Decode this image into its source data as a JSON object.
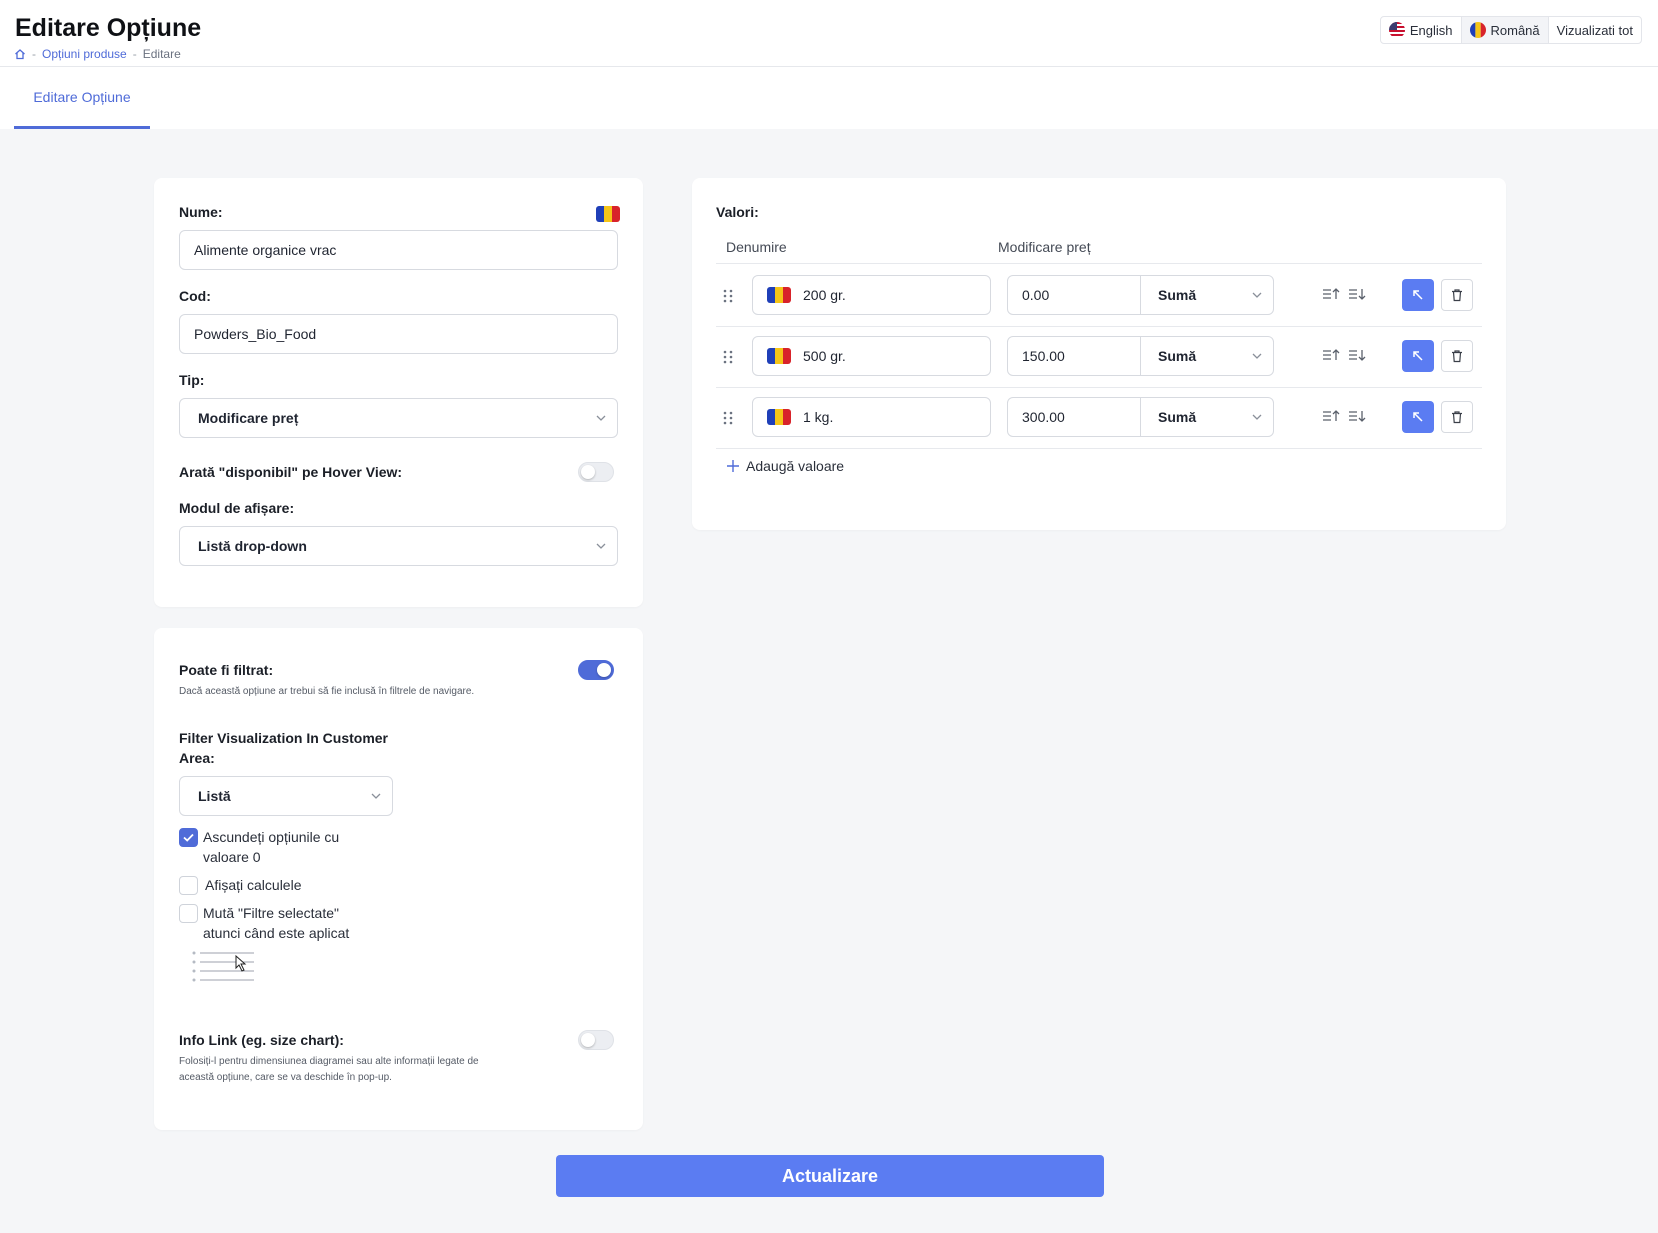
{
  "header": {
    "title": "Editare Opțiune",
    "breadcrumb": [
      "Opțiuni produse",
      "Editare"
    ],
    "languages": [
      {
        "label": "English",
        "flag": "us-flag-icon"
      },
      {
        "label": "Română",
        "flag": "ro-flag-icon",
        "active": true
      }
    ],
    "view_all": "Vizualizati tot"
  },
  "tabs": [
    {
      "label": "Editare Opțiune",
      "active": true
    }
  ],
  "form": {
    "name_label": "Nume:",
    "name_value": "Alimente organice vrac",
    "code_label": "Cod:",
    "code_value": "Powders_Bio_Food",
    "type_label": "Tip:",
    "type_value": "Modificare preț",
    "hover_label": "Arată \"disponibil\" pe Hover View:",
    "hover_on": false,
    "display_label": "Modul de afișare:",
    "display_value": "Listă drop-down"
  },
  "filter": {
    "filterable_label": "Poate fi filtrat:",
    "filterable_on": true,
    "filterable_help": "Dacă această opțiune ar trebui să fie inclusă în filtrele de navigare.",
    "viz_label_1": "Filter Visualization In Customer",
    "viz_label_2": "Area:",
    "viz_value": "Listă",
    "checks": [
      {
        "line1": "Ascundeți opțiunile cu",
        "line2": "valoare 0",
        "checked": true
      },
      {
        "line1": "Afișați calculele",
        "line2": "",
        "checked": false
      },
      {
        "line1": "Mută \"Filtre selectate\"",
        "line2": "atunci când este aplicat",
        "checked": false
      }
    ],
    "info_label": "Info Link (eg. size chart):",
    "info_on": false,
    "info_help_1": "Folosiți-l pentru dimensiunea diagramei sau alte informații legate de",
    "info_help_2": "această opțiune, care se va deschide în pop-up."
  },
  "values": {
    "title": "Valori:",
    "col_name": "Denumire",
    "col_price": "Modificare preț",
    "rows": [
      {
        "name": "200 gr.",
        "amount": "0.00",
        "type": "Sumă"
      },
      {
        "name": "500 gr.",
        "amount": "150.00",
        "type": "Sumă"
      },
      {
        "name": "1 kg.",
        "amount": "300.00",
        "type": "Sumă"
      }
    ],
    "add_label": "Adaugă valoare"
  },
  "submit_label": "Actualizare",
  "colors": {
    "accent": "#4f6bd8",
    "button": "#5b7cf2",
    "ro_blue": "#1f3fb8",
    "ro_yellow": "#f5c518",
    "ro_red": "#d8232a"
  }
}
